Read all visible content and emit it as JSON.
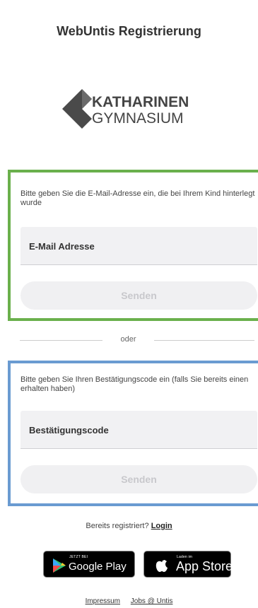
{
  "header": {
    "title": "WebUntis Registrierung"
  },
  "logo": {
    "line1": "KATHARINEN",
    "line2": "GYMNASIUM",
    "icon": "diamond-chevron-icon"
  },
  "email_section": {
    "hint": "Bitte geben Sie die E-Mail-Adresse ein, die bei Ihrem Kind hinterlegt wurde",
    "field_label": "E-Mail Adresse",
    "field_value": "",
    "send_label": "Senden",
    "border_color": "#6ab04c"
  },
  "divider": {
    "label": "oder"
  },
  "code_section": {
    "hint": "Bitte geben Sie Ihren Bestätigungscode ein (falls Sie bereits einen erhalten haben)",
    "field_label": "Bestätigungscode",
    "field_value": "",
    "send_label": "Senden",
    "border_color": "#6a9bd1"
  },
  "login_prompt": {
    "text": "Bereits registriert?",
    "link": "Login"
  },
  "stores": {
    "google_play": {
      "small": "JETZT BEI",
      "big": "Google Play",
      "icon": "play-icon"
    },
    "app_store": {
      "small": "Laden im",
      "big": "App Store",
      "icon": "apple-icon"
    }
  },
  "footer": {
    "links": [
      "Impressum",
      "Jobs @ Untis"
    ]
  }
}
